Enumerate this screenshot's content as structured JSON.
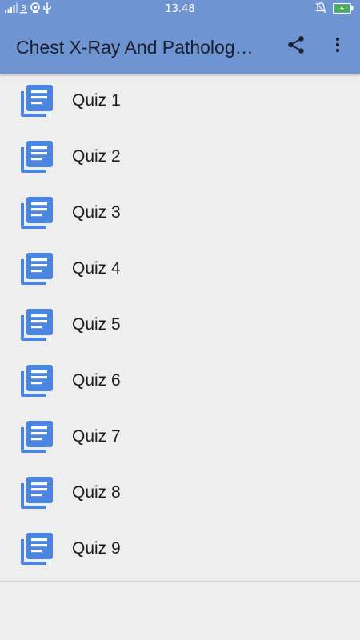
{
  "status_bar": {
    "time": "13.48",
    "icons": [
      "signal-icon",
      "data-icon",
      "wifi-icon",
      "usb-icon",
      "mute-icon",
      "battery-charging-icon"
    ]
  },
  "app_bar": {
    "title": "Chest X-Ray And Patholog…",
    "actions": [
      "share-icon",
      "more-vert-icon"
    ]
  },
  "colors": {
    "app_bar": "#6f94d2",
    "background": "#eeeeee",
    "icon": "#4a86e0",
    "battery": "#4caf50"
  },
  "list": {
    "items": [
      {
        "label": "Quiz 1",
        "icon": "library-books-icon"
      },
      {
        "label": "Quiz 2",
        "icon": "library-books-icon"
      },
      {
        "label": "Quiz 3",
        "icon": "library-books-icon"
      },
      {
        "label": "Quiz 4",
        "icon": "library-books-icon"
      },
      {
        "label": "Quiz 5",
        "icon": "library-books-icon"
      },
      {
        "label": "Quiz 6",
        "icon": "library-books-icon"
      },
      {
        "label": "Quiz 7",
        "icon": "library-books-icon"
      },
      {
        "label": "Quiz 8",
        "icon": "library-books-icon"
      },
      {
        "label": "Quiz 9",
        "icon": "library-books-icon"
      }
    ]
  }
}
